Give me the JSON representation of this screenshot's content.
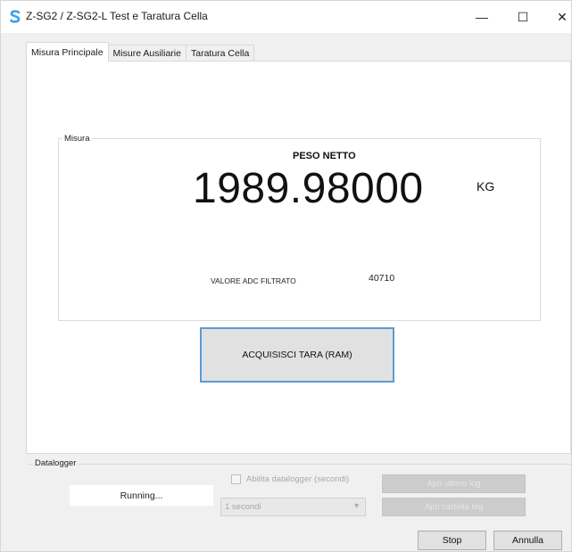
{
  "window": {
    "title": "Z-SG2 / Z-SG2-L Test e Taratura Cella",
    "minimize_glyph": "—",
    "maximize_glyph": "☐",
    "close_glyph": "✕",
    "icon": "app-s-icon"
  },
  "tabs": [
    {
      "label": "Misura Principale",
      "active": true
    },
    {
      "label": "Misure Ausiliarie",
      "active": false
    },
    {
      "label": "Taratura Cella",
      "active": false
    }
  ],
  "measure": {
    "group_title": "Misura",
    "header": "PESO NETTO",
    "value": "1989.98000",
    "unit": "KG",
    "adc_label": "VALORE ADC FILTRATO",
    "adc_value": "40710"
  },
  "tara_button": "ACQUISISCI TARA (RAM)",
  "datalogger": {
    "group_title": "Datalogger",
    "status": "Running...",
    "checkbox_label": "Abilita datalogger (secondi)",
    "interval_value": "1 secondi",
    "button_1": "Apri ultimo log",
    "button_2": "Apri cartella log"
  },
  "footer": {
    "stop_label": "Stop",
    "cancel_label": "Annulla"
  },
  "colors": {
    "accent_border": "#5b9bd5",
    "app_icon": "#3aa0e8"
  }
}
